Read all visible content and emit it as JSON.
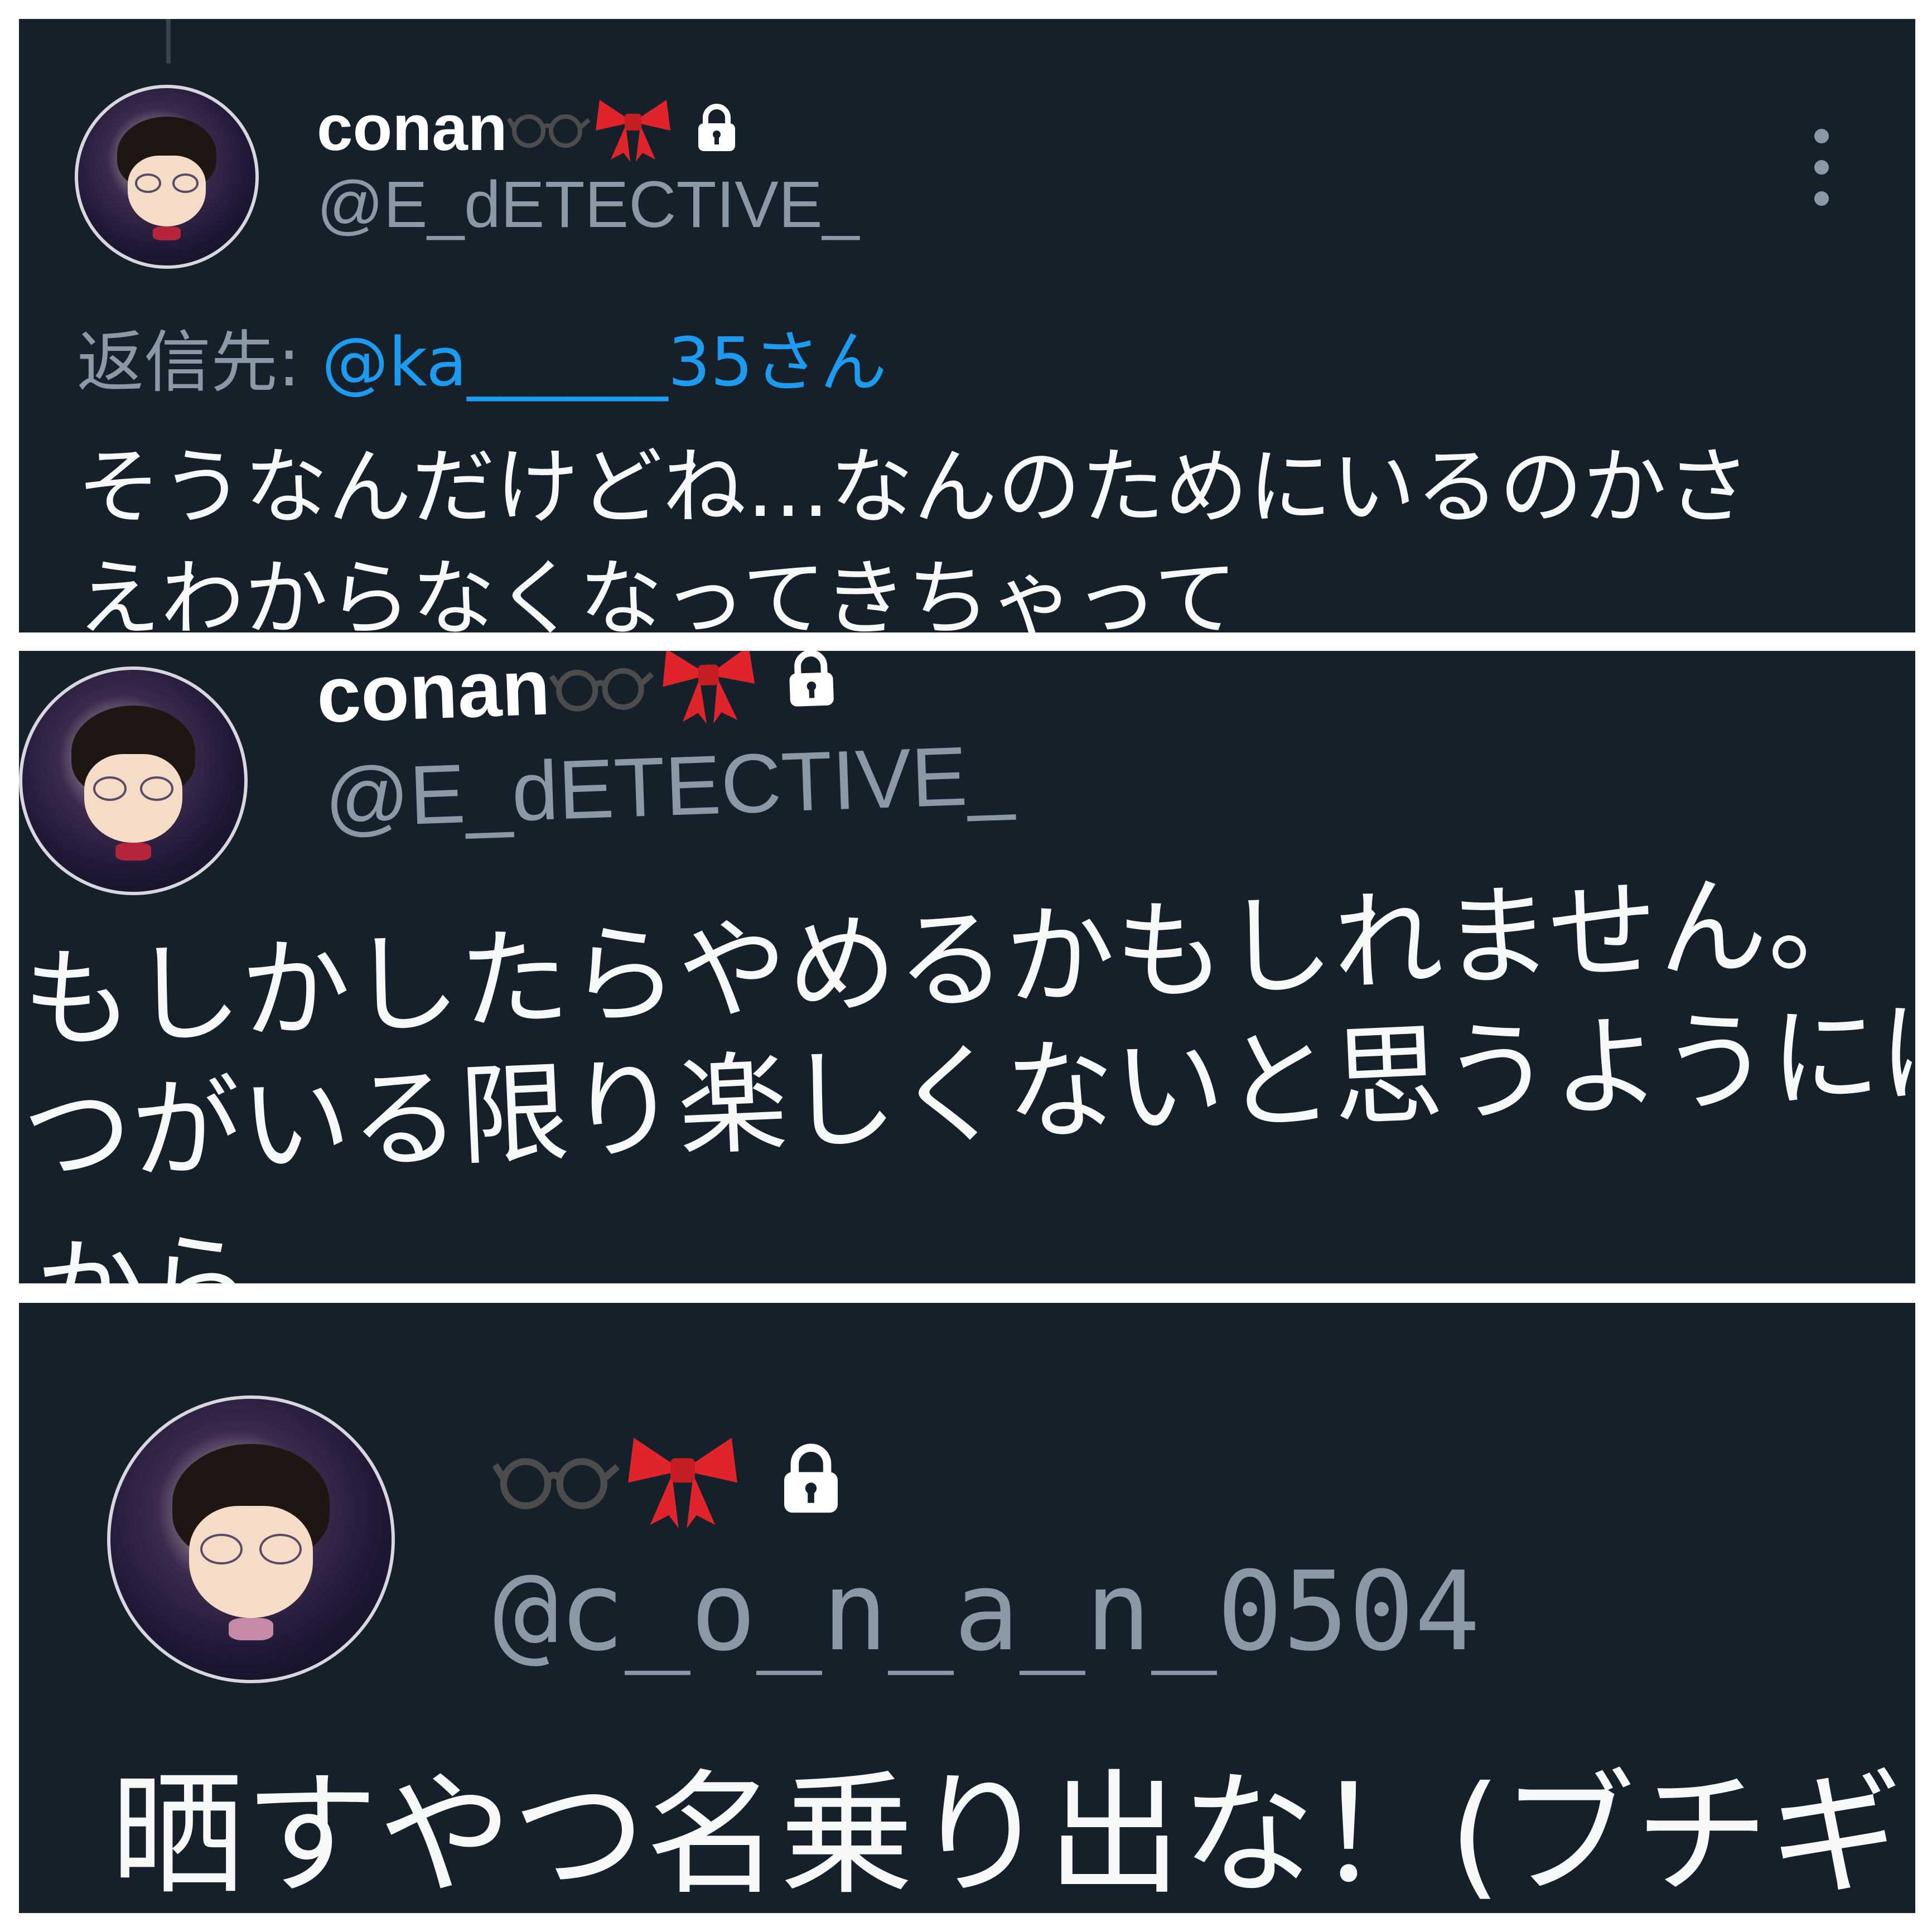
{
  "tweets": [
    {
      "display_name": "conan",
      "handle": "@E_dETECTIVE_",
      "reply_label": "返信先:",
      "reply_to": "@ka______35さん",
      "text_lines": [
        "そうなんだけどね…なんのためにいるのかさ",
        "えわからなくなってきちゃって"
      ],
      "icons": [
        "glasses-icon",
        "ribbon-icon",
        "lock-icon",
        "more-options-icon"
      ]
    },
    {
      "display_name": "conan",
      "handle": "@E_dETECTIVE_",
      "text_lines": [
        "もしかしたらやめるかもしれません。",
        "つがいる限り楽しくないと思うようには",
        "から"
      ],
      "icons": [
        "glasses-icon",
        "ribbon-icon",
        "lock-icon"
      ]
    },
    {
      "display_name": "",
      "handle": "@c_o_n_a_n_0504",
      "text_lines": [
        "晒すやつ名乗り出な！(ブチギ"
      ],
      "icons": [
        "glasses-icon",
        "ribbon-icon",
        "lock-icon"
      ]
    }
  ],
  "colors": {
    "panel_bg": "#15202b",
    "text": "#f7f9f9",
    "secondary": "#8b98a5",
    "link": "#1d9bf0",
    "ribbon": "#e0242b"
  }
}
